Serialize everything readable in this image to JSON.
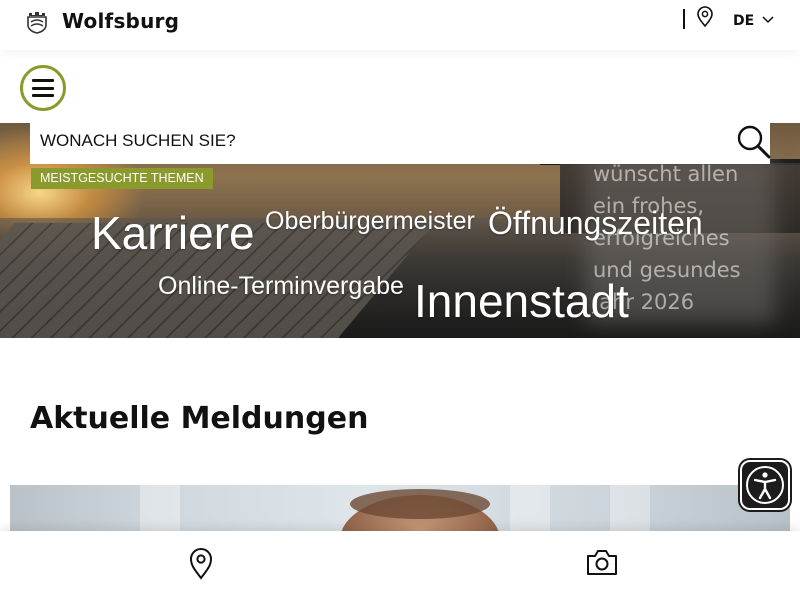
{
  "header": {
    "brand": "Wolfsburg",
    "language": "DE",
    "icons": {
      "crest": "wolfsburg-crest-icon",
      "location": "map-pin-icon",
      "chevron": "chevron-down-icon"
    }
  },
  "menu": {
    "icon": "hamburger-menu-icon"
  },
  "search": {
    "placeholder": "WONACH SUCHEN SIE?",
    "icon": "search-icon"
  },
  "topics": {
    "tag_label": "MEISTGESUCHTE THEMEN",
    "keywords": [
      "Karriere",
      "Oberbürgermeister",
      "Öffnungszeiten",
      "Online-Terminvergabe",
      "Innenstadt"
    ]
  },
  "greeting": {
    "lines": [
      "wünscht allen",
      "ein frohes,",
      "erfolgreiches",
      "und gesundes",
      "Jahr 2026"
    ]
  },
  "news": {
    "title": "Aktuelle Meldungen"
  },
  "accessibility": {
    "icon": "accessibility-person-icon"
  },
  "bottom_nav": {
    "icons": [
      "map-pin-icon",
      "camera-icon"
    ]
  },
  "colors": {
    "accent": "#8a9a2c",
    "text": "#111111",
    "background": "#ffffff"
  }
}
